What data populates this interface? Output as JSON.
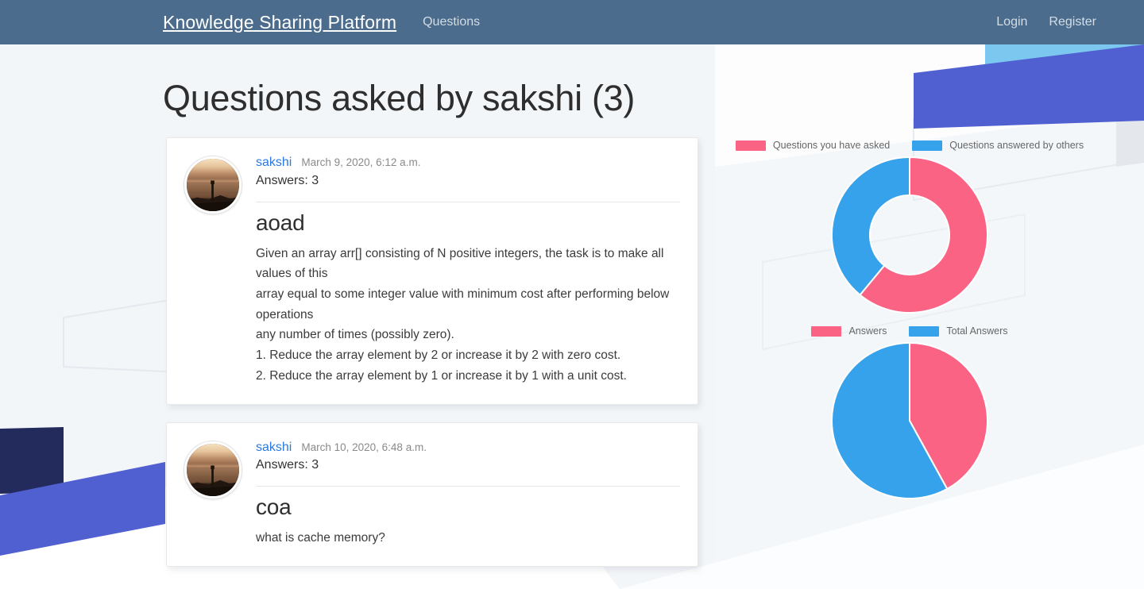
{
  "navbar": {
    "brand": "Knowledge Sharing Platform",
    "left_links": [
      {
        "label": "Questions",
        "name": "nav-link-questions"
      }
    ],
    "right_links": [
      {
        "label": "Login",
        "name": "nav-link-login"
      },
      {
        "label": "Register",
        "name": "nav-link-register"
      }
    ],
    "background_color": "#4b6c8c"
  },
  "page": {
    "title": "Questions asked by sakshi (3)"
  },
  "questions": [
    {
      "author": "sakshi",
      "date": "March 9, 2020, 6:12 a.m.",
      "answers": "Answers: 3",
      "title": "aoad",
      "body": "Given an array arr[] consisting of N positive integers, the task is to make all values of this\narray equal to some integer value with minimum cost after performing below operations\nany number of times (possibly zero).\n1. Reduce the array element by 2 or increase it by 2 with zero cost.\n2. Reduce the array element by 1 or increase it by 1 with a unit cost."
    },
    {
      "author": "sakshi",
      "date": "March 10, 2020, 6:48 a.m.",
      "answers": "Answers: 3",
      "title": "coa",
      "body": "what is cache memory?"
    }
  ],
  "colors": {
    "pink": "#fb6384",
    "blue": "#36a2eb",
    "navbar": "#4b6c8c",
    "link": "#2a7ae2",
    "decor_purple": "#5160d1",
    "decor_navy": "#232a5c",
    "decor_lightblue": "#7cc7ef",
    "page_bg_tint": "#f2f6f9"
  },
  "chart_data": [
    {
      "type": "pie",
      "variant": "doughnut",
      "title": "",
      "legend_position": "top",
      "labels": [
        "Questions you have asked",
        "Questions answered by others"
      ],
      "values": [
        61,
        39
      ],
      "colors": [
        "#fb6384",
        "#36a2eb"
      ],
      "legend": [
        {
          "label": "Questions you have asked",
          "color": "#fb6384"
        },
        {
          "label": "Questions answered by others",
          "color": "#36a2eb"
        }
      ]
    },
    {
      "type": "pie",
      "variant": "pie",
      "title": "",
      "legend_position": "top",
      "labels": [
        "Answers",
        "Total Answers"
      ],
      "values": [
        42,
        58
      ],
      "colors": [
        "#fb6384",
        "#36a2eb"
      ],
      "legend": [
        {
          "label": "Answers",
          "color": "#fb6384"
        },
        {
          "label": "Total Answers",
          "color": "#36a2eb"
        }
      ]
    }
  ]
}
